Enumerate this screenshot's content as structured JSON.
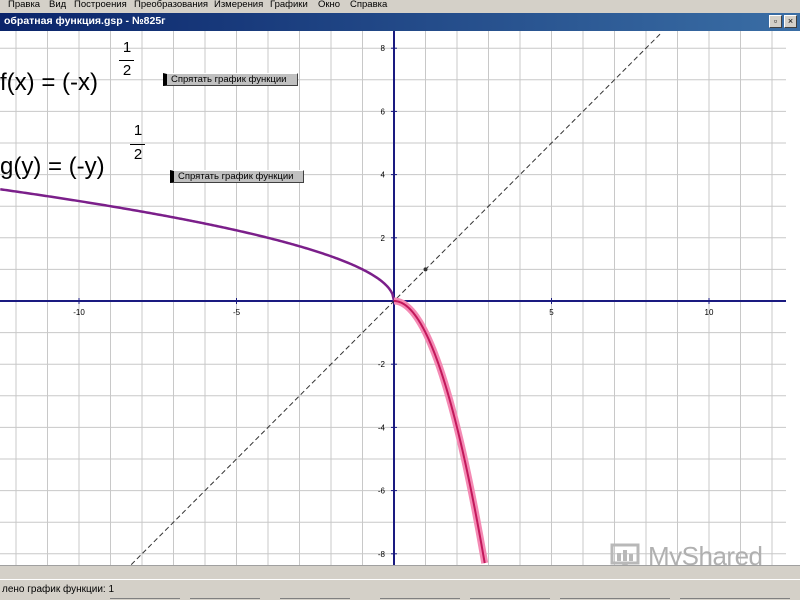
{
  "menu": [
    "Правка",
    "Вид",
    "Построения",
    "Преобразования",
    "Измерения",
    "Графики",
    "Окно",
    "Справка"
  ],
  "window": {
    "title": "обратная функция.gsp - №825г",
    "close_glyph": "×"
  },
  "formulas": {
    "f": {
      "text": "f(x) = (-x)",
      "exp_num": "1",
      "exp_den": "2"
    },
    "g": {
      "text": "g(y) = (-y)",
      "exp_num": "1",
      "exp_den": "2"
    }
  },
  "buttons": {
    "hide_f": "Спрятать график функции",
    "hide_g": "Спрятать график функции"
  },
  "chart_data": {
    "type": "line",
    "xlim": [
      -12.5,
      12.9
    ],
    "ylim": [
      -8.4,
      8.4
    ],
    "grid": true,
    "x_ticks": [
      -10,
      -5,
      5,
      10
    ],
    "y_ticks": [
      8,
      6,
      4,
      2,
      -2,
      -4,
      -6,
      -8
    ],
    "series": [
      {
        "name": "f(x) = (-x)^(1/2)",
        "color": "#7b1f8a",
        "function": "sqrt(-x)",
        "domain": [
          -12.5,
          0
        ]
      },
      {
        "name": "g(y) = (-y)^(1/2)",
        "color": "#e0206a",
        "function": "-x^2",
        "domain": [
          0,
          2.9
        ]
      },
      {
        "name": "y = x",
        "color": "#333333",
        "style": "dashed",
        "function": "x",
        "domain": [
          -8.4,
          8.4
        ]
      }
    ],
    "marked_point": {
      "x": 1,
      "y": 1
    }
  },
  "watermark": {
    "text": "MyShared"
  },
  "status": {
    "text": "лено график функции: 1"
  }
}
